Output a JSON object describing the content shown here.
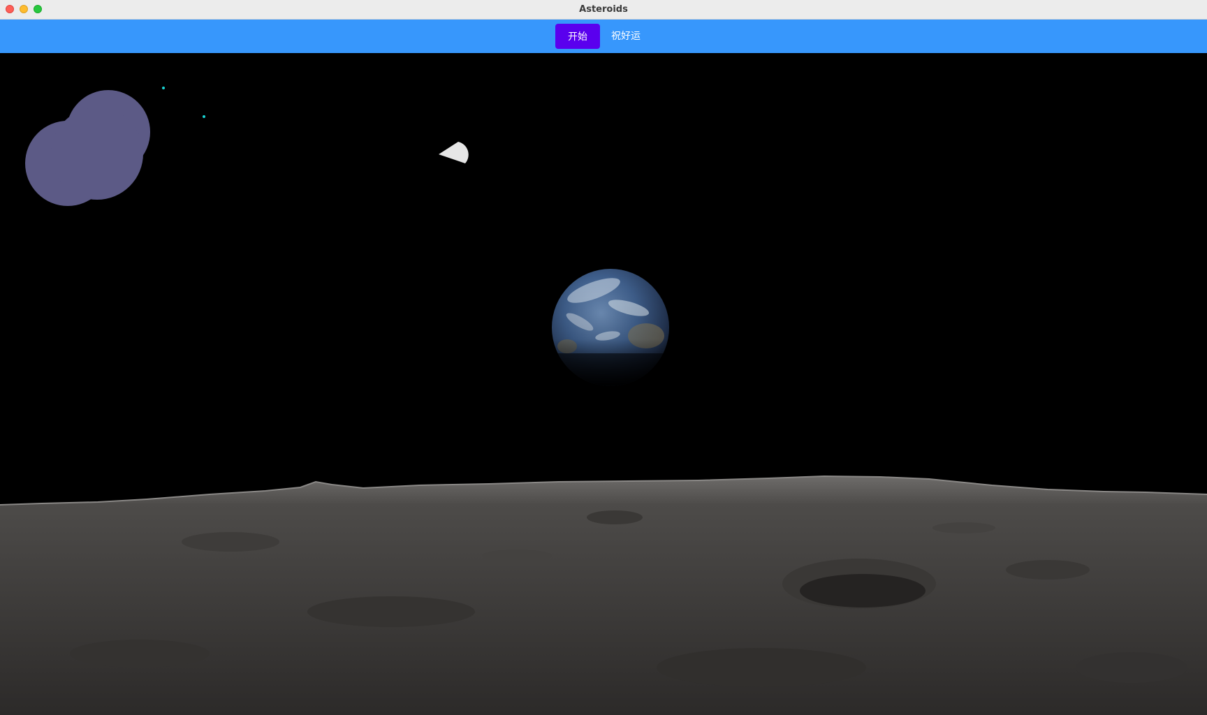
{
  "window": {
    "title": "Asteroids"
  },
  "toolbar": {
    "start_label": "开始",
    "luck_text": "祝好运"
  },
  "game": {
    "background_color": "#000000",
    "asteroid_color": "#5c5a86",
    "bullet_color": "#19d3d3",
    "ship_color": "#e6e6e6",
    "planet": "earth",
    "ground": "lunar-surface"
  }
}
